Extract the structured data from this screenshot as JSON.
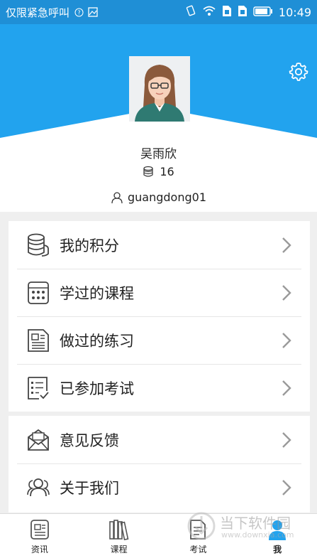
{
  "status_bar": {
    "carrier": "仅限紧急呼叫",
    "time": "10:49"
  },
  "profile": {
    "name": "吴雨欣",
    "points": "16",
    "account": "guangdong01"
  },
  "menu": {
    "group1": [
      {
        "label": "我的积分",
        "icon": "coins-icon"
      },
      {
        "label": "学过的课程",
        "icon": "calculator-icon"
      },
      {
        "label": "做过的练习",
        "icon": "document-icon"
      },
      {
        "label": "已参加考试",
        "icon": "checklist-icon"
      }
    ],
    "group2": [
      {
        "label": "意见反馈",
        "icon": "mail-icon"
      },
      {
        "label": "关于我们",
        "icon": "people-icon"
      }
    ]
  },
  "bottom_nav": [
    {
      "label": "资讯",
      "icon": "news-icon"
    },
    {
      "label": "课程",
      "icon": "books-icon"
    },
    {
      "label": "考试",
      "icon": "exam-icon"
    },
    {
      "label": "我",
      "icon": "person-icon",
      "active": true
    }
  ],
  "colors": {
    "header_blue": "#22a3ee",
    "status_blue": "#1f8fd6",
    "active_blue": "#22a3ee"
  }
}
